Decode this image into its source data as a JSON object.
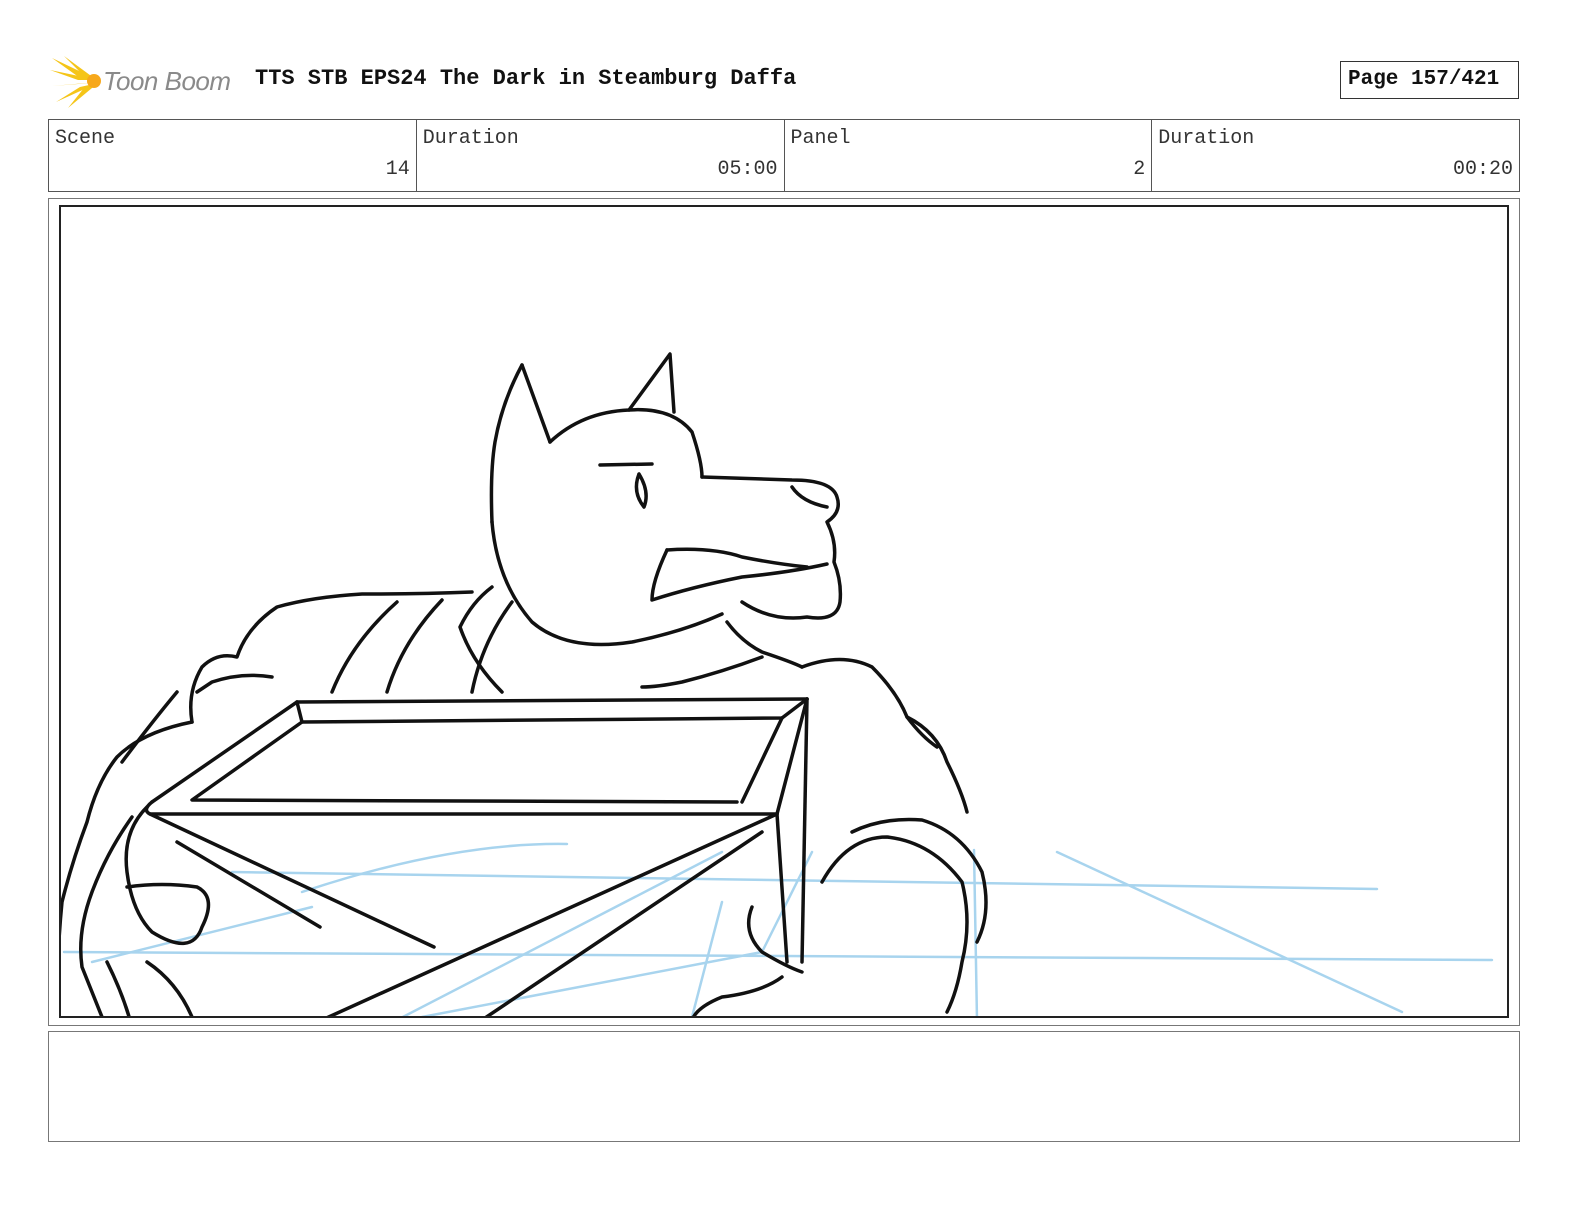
{
  "header": {
    "logo_text": "Toon Boom",
    "title": "TTS STB EPS24 The Dark in Steamburg Daffa",
    "page_label": "Page 157/421"
  },
  "info": {
    "scene_label": "Scene",
    "scene_value": "14",
    "scene_duration_label": "Duration",
    "scene_duration_value": "05:00",
    "panel_label": "Panel",
    "panel_value": "2",
    "panel_duration_label": "Duration",
    "panel_duration_value": "00:20"
  },
  "panel_image": {
    "icon": "storyboard-sketch",
    "line_color": "#111111",
    "guide_color": "#a8d4ee"
  },
  "notes": {
    "text": ""
  },
  "colors": {
    "logo_accent": "#f5c518",
    "logo_text": "#8a8a8a"
  }
}
